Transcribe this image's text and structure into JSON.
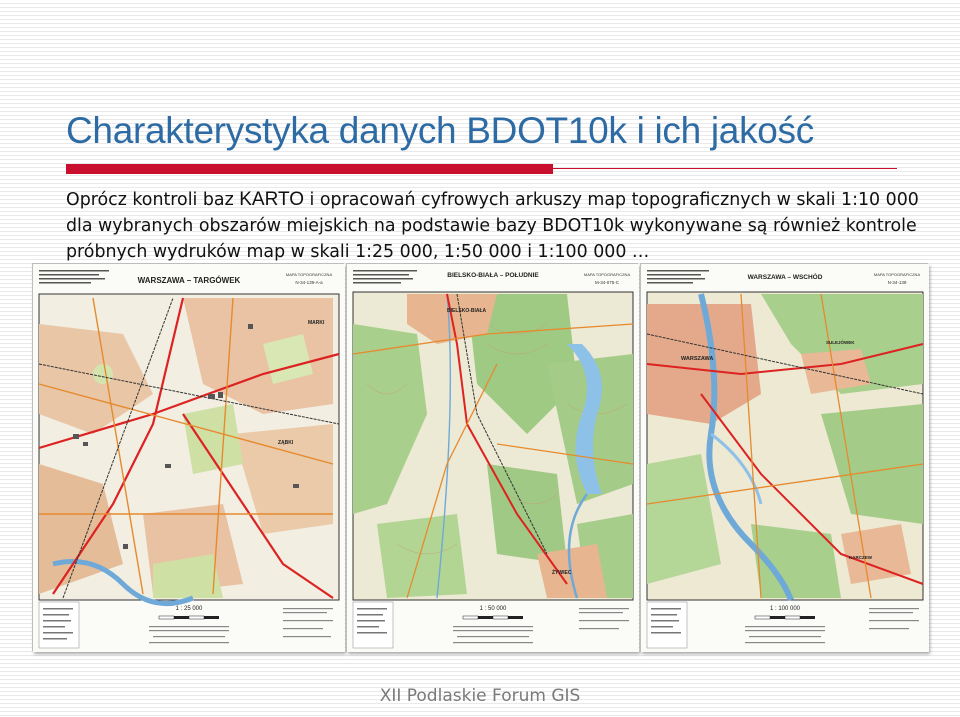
{
  "slide": {
    "title": "Charakterystyka danych BDOT10k i ich jakość",
    "body": {
      "p1": "Oprócz kontroli baz ",
      "karto": "KARTO",
      "p2": " i opracowań cyfrowych arkuszy map topograficznych w skali 1:10 000 dla wybranych obszarów miejskich na podstawie bazy ",
      "bdot": "BDOT10k",
      "p3": " wykonywane są również kontrole próbnych wydruków map w skali 1:25 000, 1:50 000 i 1:100 000 …"
    },
    "footer": "XII Podlaskie Forum GIS"
  },
  "maps": [
    {
      "title": "WARSZAWA – TARGÓWEK",
      "series": "MAPA TOPOGRAFICZNA",
      "sheet": "N-34-139-A-a",
      "scale": "1 : 25 000",
      "places": [
        "MARKI",
        "ZĄBKI"
      ]
    },
    {
      "title": "BIELSKO-BIAŁA – POŁUDNIE",
      "series": "MAPA TOPOGRAFICZNA",
      "sheet": "M-34-075-C",
      "scale": "1 : 50 000",
      "places": [
        "BIELSKO-BIAŁA",
        "ŻYWIEC"
      ]
    },
    {
      "title": "WARSZAWA – WSCHÓD",
      "series": "MAPA TOPOGRAFICZNA",
      "sheet": "N-34-139",
      "scale": "1 : 100 000",
      "places": [
        "WARSZAWA",
        "SULEJÓWEK",
        "KARCZEW"
      ]
    }
  ],
  "colors": {
    "title": "#2c6ba3",
    "rule": "#c8102e",
    "text": "#111111",
    "footer": "#7a7a7a"
  }
}
